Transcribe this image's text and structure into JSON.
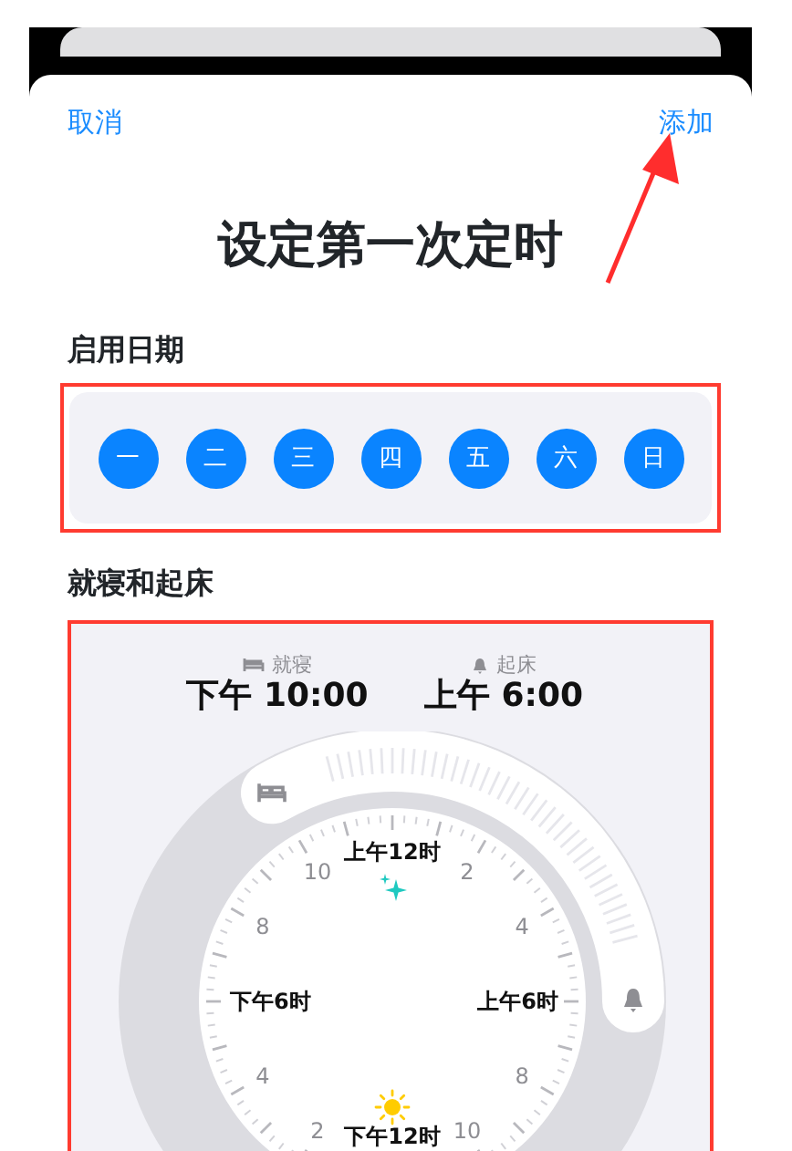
{
  "nav": {
    "cancel": "取消",
    "add": "添加"
  },
  "title": "设定第一次定时",
  "days_section": {
    "heading": "启用日期",
    "highlighted": true,
    "days": [
      {
        "label": "一",
        "selected": true
      },
      {
        "label": "二",
        "selected": true
      },
      {
        "label": "三",
        "selected": true
      },
      {
        "label": "四",
        "selected": true
      },
      {
        "label": "五",
        "selected": true
      },
      {
        "label": "六",
        "selected": true
      },
      {
        "label": "日",
        "selected": true
      }
    ]
  },
  "sleep_section": {
    "heading": "就寝和起床",
    "highlighted": true,
    "bedtime": {
      "label": "就寝",
      "time": "下午 10:00"
    },
    "wake": {
      "label": "起床",
      "time": "上午 6:00"
    },
    "dial_labels": [
      {
        "text": "上午12时",
        "kind": "top"
      },
      {
        "text": "10",
        "kind": "left"
      },
      {
        "text": "2",
        "kind": "right"
      },
      {
        "text": "8",
        "kind": "left"
      },
      {
        "text": "4",
        "kind": "right"
      },
      {
        "text": "下午6时",
        "kind": "left"
      },
      {
        "text": "上午6时",
        "kind": "right"
      },
      {
        "text": "4",
        "kind": "left"
      },
      {
        "text": "8",
        "kind": "right"
      },
      {
        "text": "2",
        "kind": "left"
      },
      {
        "text": "下午12时",
        "kind": "bottom"
      },
      {
        "text": "10",
        "kind": "right"
      }
    ]
  },
  "annotation": {
    "arrow_to_add": true
  }
}
